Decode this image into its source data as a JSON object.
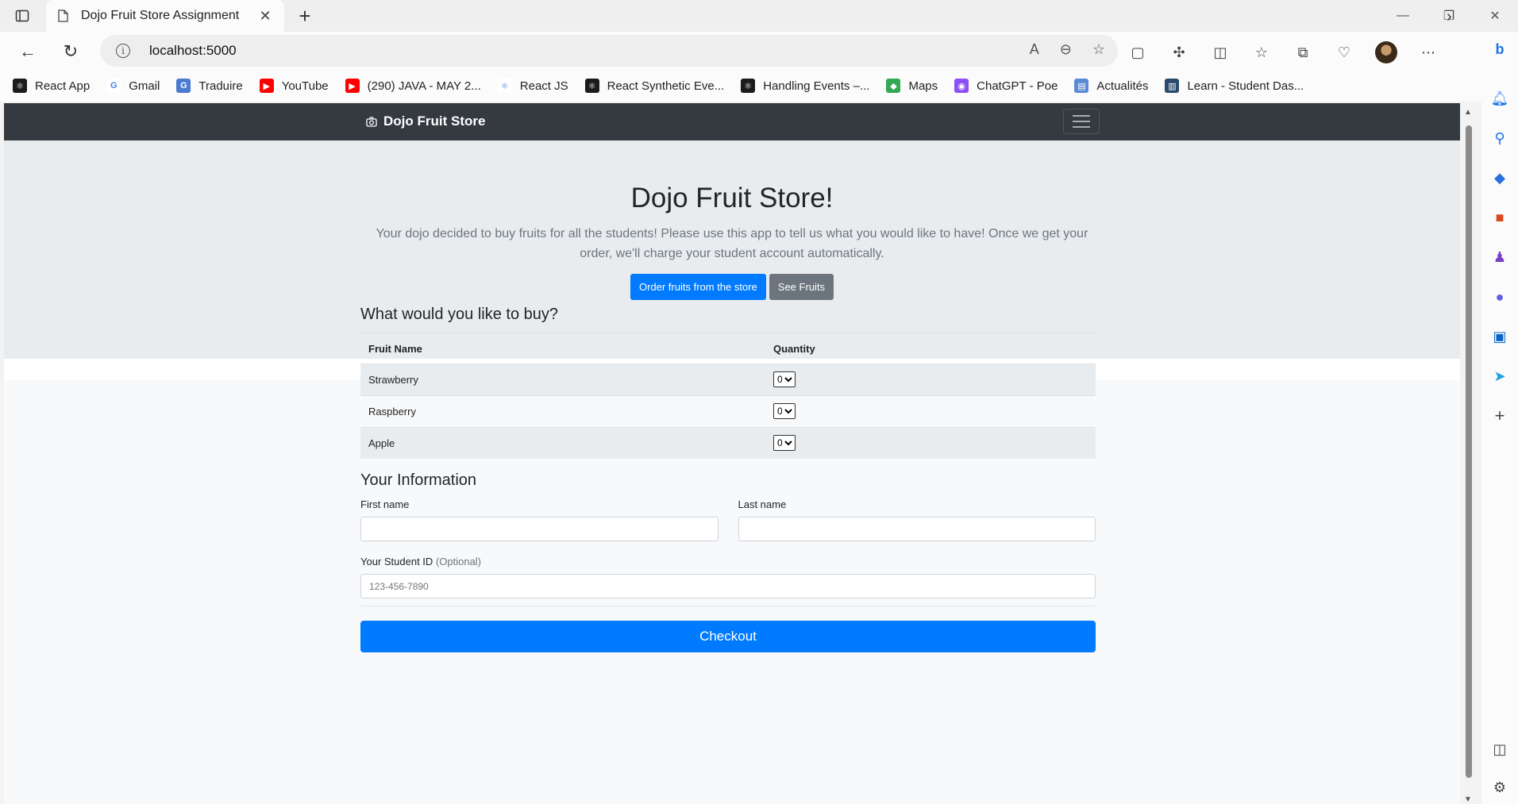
{
  "browser": {
    "tab_title": "Dojo Fruit Store Assignment",
    "url": "localhost:5000",
    "bookmarks": [
      {
        "label": "React App",
        "color": "#1b1b1b",
        "glyph": "⚛"
      },
      {
        "label": "Gmail",
        "color": "#ffffff",
        "glyph": "G"
      },
      {
        "label": "Traduire",
        "color": "#4a7bd0",
        "glyph": "G"
      },
      {
        "label": "YouTube",
        "color": "#ff0000",
        "glyph": "▶"
      },
      {
        "label": "(290) JAVA - MAY 2...",
        "color": "#ff0000",
        "glyph": "▶"
      },
      {
        "label": "React JS",
        "color": "#ffffff",
        "glyph": "⚛"
      },
      {
        "label": "React Synthetic Eve...",
        "color": "#1b1b1b",
        "glyph": "⚛"
      },
      {
        "label": "Handling Events –...",
        "color": "#1b1b1b",
        "glyph": "⚛"
      },
      {
        "label": "Maps",
        "color": "#34a853",
        "glyph": "◆"
      },
      {
        "label": "ChatGPT - Poe",
        "color": "#8c4ff6",
        "glyph": "◉"
      },
      {
        "label": "Actualités",
        "color": "#5a8ad6",
        "glyph": "▤"
      },
      {
        "label": "Learn - Student Das...",
        "color": "#2b4a6a",
        "glyph": "▥"
      }
    ]
  },
  "navbar": {
    "brand": "Dojo Fruit Store"
  },
  "jumbotron": {
    "heading": "Dojo Fruit Store!",
    "lead": "Your dojo decided to buy fruits for all the students! Please use this app to tell us what you would like to have! Once we get your order, we'll charge your student account automatically.",
    "primary_button": "Order fruits from the store",
    "secondary_button": "See Fruits"
  },
  "order": {
    "title": "What would you like to buy?",
    "col_fruit": "Fruit Name",
    "col_quantity": "Quantity",
    "rows": [
      {
        "fruit": "Strawberry",
        "quantity": "0"
      },
      {
        "fruit": "Raspberry",
        "quantity": "0"
      },
      {
        "fruit": "Apple",
        "quantity": "0"
      }
    ]
  },
  "info": {
    "title": "Your Information",
    "first_name_label": "First name",
    "last_name_label": "Last name",
    "first_name_value": "",
    "last_name_value": "",
    "student_id_label": "Your Student ID",
    "student_id_optional": "(Optional)",
    "student_id_placeholder": "123-456-7890",
    "checkout_button": "Checkout"
  }
}
